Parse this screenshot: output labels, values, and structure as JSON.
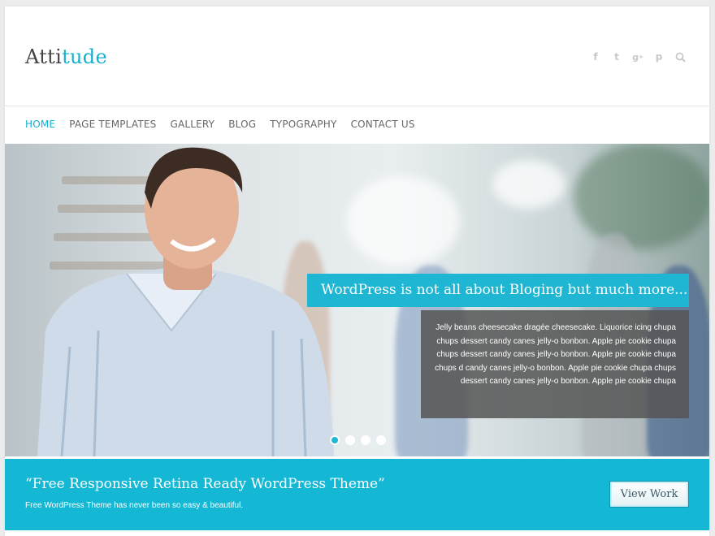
{
  "site": {
    "logo_part1": "Atti",
    "logo_part2": "tude",
    "accent_color": "#14b1cf"
  },
  "header": {
    "social_icons": [
      "facebook-icon",
      "twitter-icon",
      "google-plus-icon",
      "pinterest-icon",
      "search-icon"
    ]
  },
  "nav": {
    "items": [
      {
        "label": "HOME",
        "active": true
      },
      {
        "label": "PAGE TEMPLATES",
        "active": false
      },
      {
        "label": "GALLERY",
        "active": false
      },
      {
        "label": "BLOG",
        "active": false
      },
      {
        "label": "TYPOGRAPHY",
        "active": false
      },
      {
        "label": "CONTACT US",
        "active": false
      }
    ]
  },
  "slider": {
    "caption_title": "WordPress is not all about Bloging but much more...",
    "caption_body": "Jelly beans cheesecake dragée cheesecake. Liquorice icing chupa chups dessert candy canes jelly-o bonbon. Apple pie cookie chupa chups dessert candy canes jelly-o bonbon. Apple pie cookie chupa chups d candy canes jelly-o bonbon. Apple pie cookie chupa chups dessert candy canes jelly-o bonbon. Apple pie cookie chupa",
    "slide_count": 4,
    "active_slide": 1
  },
  "promo": {
    "title": "“Free Responsive Retina Ready WordPress Theme”",
    "subtitle": "Free WordPress Theme has never been so easy & beautiful.",
    "button_label": "View Work"
  }
}
